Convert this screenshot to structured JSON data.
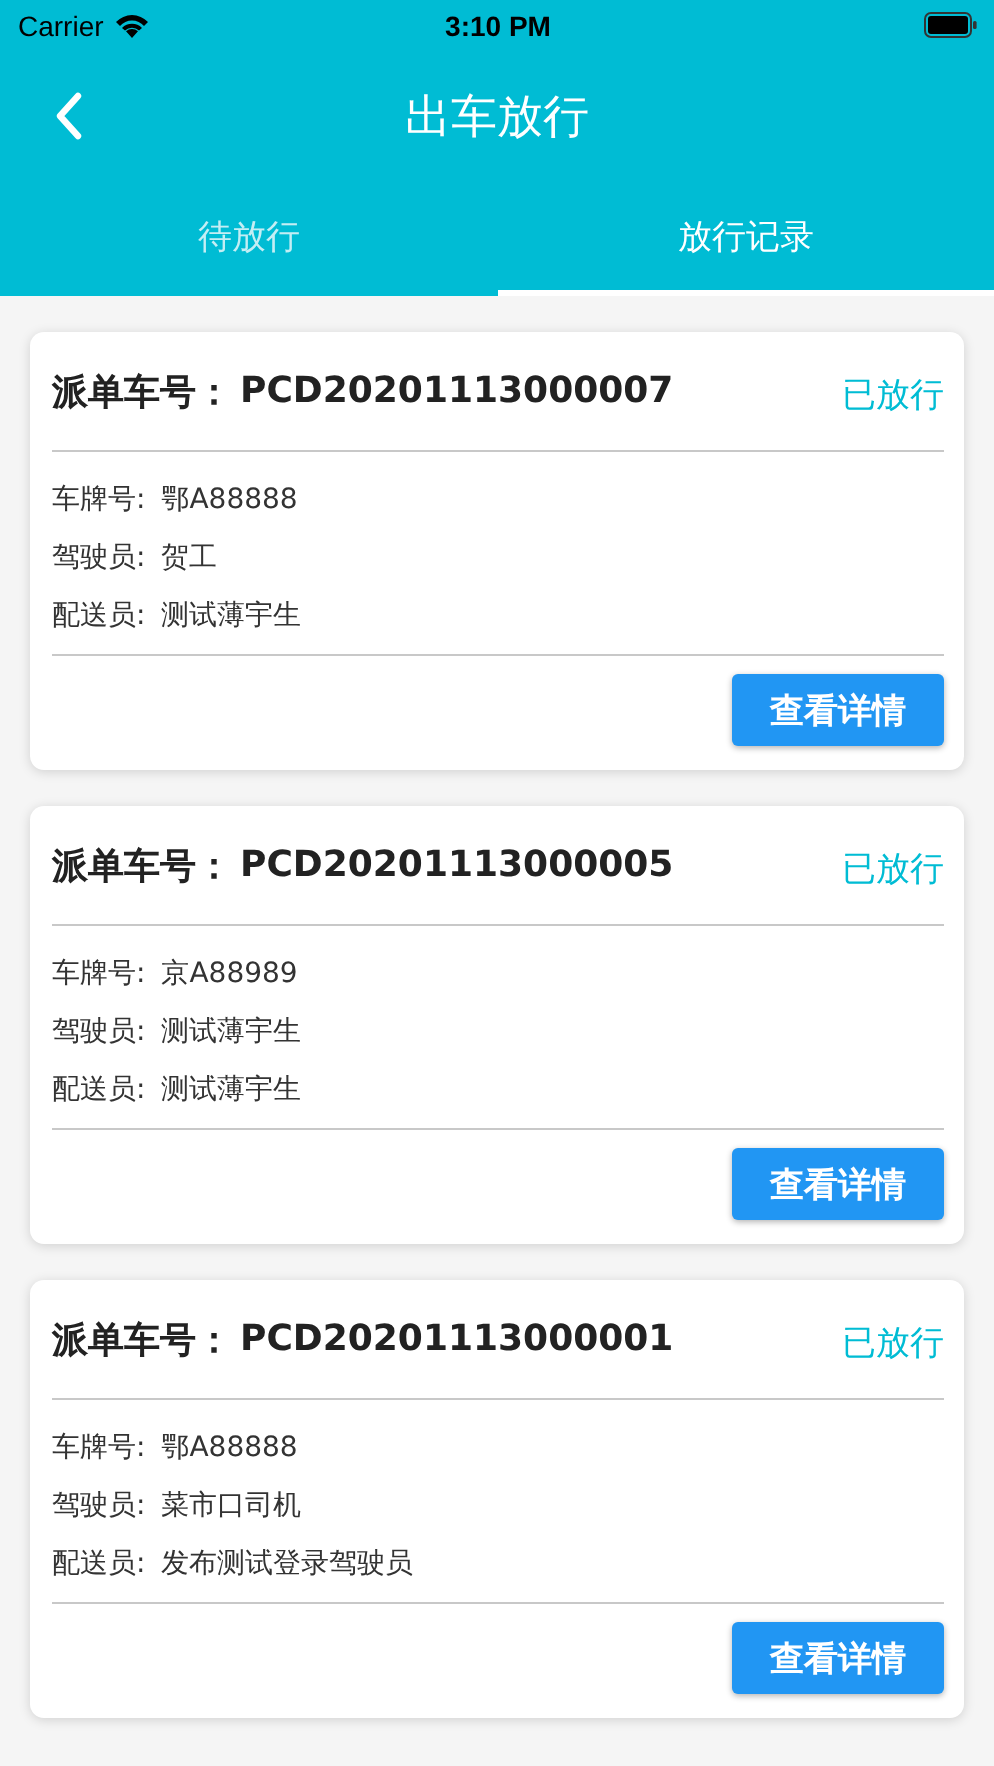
{
  "status_bar": {
    "carrier": "Carrier",
    "time": "3:10 PM"
  },
  "nav_bar": {
    "title": "出车放行"
  },
  "tabs": [
    {
      "label": "待放行",
      "selected": false
    },
    {
      "label": "放行记录",
      "selected": true
    }
  ],
  "orders": [
    {
      "order_label": "派单车号：",
      "order_no": "PCD20201113000007",
      "status": "已放行",
      "fields": [
        {
          "label": "车牌号:",
          "value": "鄂A88888"
        },
        {
          "label": "驾驶员:",
          "value": "贺工"
        },
        {
          "label": "配送员:",
          "value": "测试薄宇生"
        }
      ],
      "button": "查看详情"
    },
    {
      "order_label": "派单车号：",
      "order_no": "PCD20201113000005",
      "status": "已放行",
      "fields": [
        {
          "label": "车牌号:",
          "value": "京A88989"
        },
        {
          "label": "驾驶员:",
          "value": "测试薄宇生"
        },
        {
          "label": "配送员:",
          "value": "测试薄宇生"
        }
      ],
      "button": "查看详情"
    },
    {
      "order_label": "派单车号：",
      "order_no": "PCD20201113000001",
      "status": "已放行",
      "fields": [
        {
          "label": "车牌号:",
          "value": "鄂A88888"
        },
        {
          "label": "驾驶员:",
          "value": "菜市口司机"
        },
        {
          "label": "配送员:",
          "value": "发布测试登录驾驶员"
        }
      ],
      "button": "查看详情"
    }
  ]
}
